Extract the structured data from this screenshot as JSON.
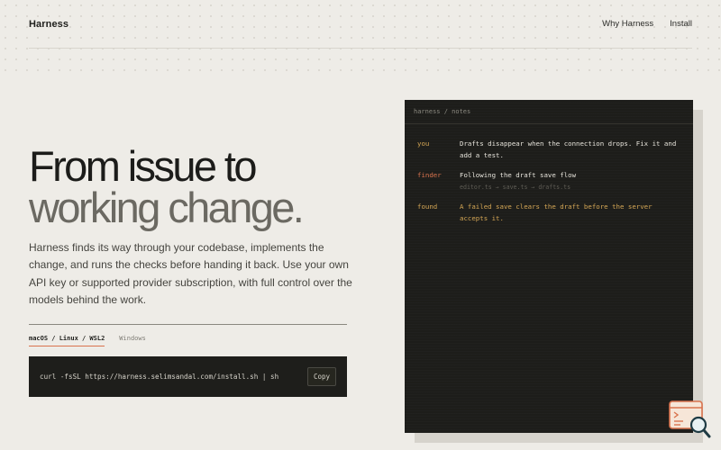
{
  "nav": {
    "brand": "Harness",
    "links": [
      "Why Harness",
      "Install"
    ]
  },
  "hero": {
    "title_line1": "From issue to",
    "title_line2": "working change.",
    "description": "Harness finds its way through your codebase, implements the change, and runs the checks before handing it back. Use your own API key or supported provider subscription, with full control over the models behind the work."
  },
  "install": {
    "tabs": [
      "macOS / Linux / WSL2",
      "Windows"
    ],
    "active_tab": "macOS / Linux / WSL2",
    "command": "curl -fsSL https://harness.selimsandal.com/install.sh | sh",
    "copy_label": "Copy"
  },
  "terminal": {
    "title": "harness / notes",
    "messages": [
      {
        "who": "you",
        "text": "Drafts disappear when the connection drops. Fix it and add a test.",
        "sub": ""
      },
      {
        "who": "finder",
        "text": "Following the draft save flow",
        "sub": "editor.ts → save.ts → drafts.ts"
      },
      {
        "who": "found",
        "text": "A failed save clears the draft before the server accepts it.",
        "sub": ""
      }
    ]
  },
  "colors": {
    "background": "#eeece7",
    "terminal_bg": "#1d1d1a",
    "accent_orange": "#d9734e",
    "accent_gold": "#d4a655"
  }
}
